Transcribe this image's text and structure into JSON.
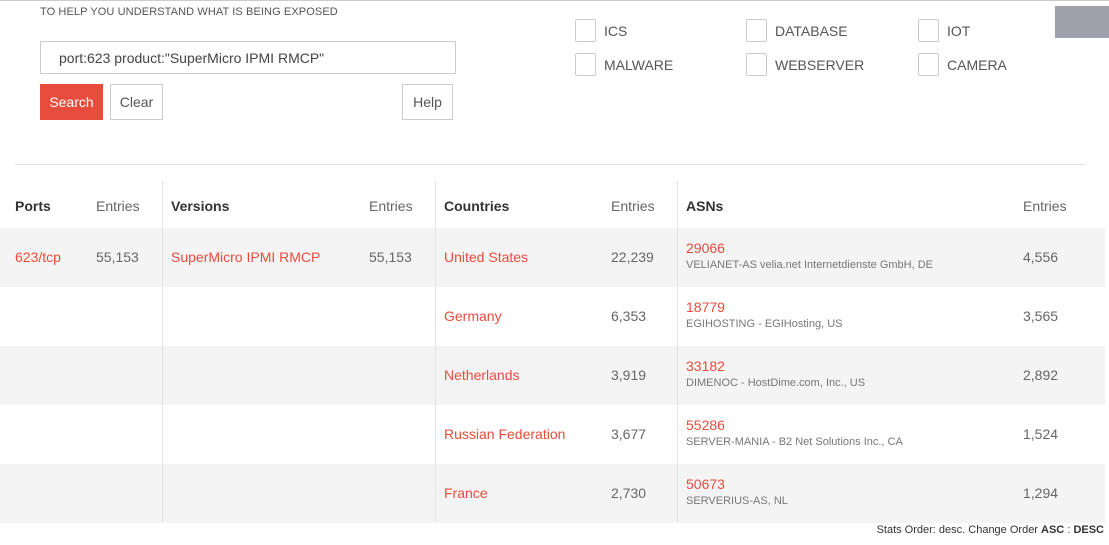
{
  "hint_text": "TO HELP YOU UNDERSTAND WHAT IS BEING EXPOSED",
  "search": {
    "query_value": "port:623 product:\"SuperMicro IPMI RMCP\"",
    "search_label": "Search",
    "clear_label": "Clear",
    "help_label": "Help"
  },
  "filters": [
    "ICS",
    "DATABASE",
    "IOT",
    "MALWARE",
    "WEBSERVER",
    "CAMERA"
  ],
  "headers": {
    "ports": "Ports",
    "versions": "Versions",
    "countries": "Countries",
    "asns": "ASNs",
    "entries": "Entries"
  },
  "ports": [
    {
      "port": "623/tcp",
      "entries": "55,153"
    }
  ],
  "versions": [
    {
      "version": "SuperMicro IPMI RMCP",
      "entries": "55,153"
    }
  ],
  "countries": [
    {
      "name": "United States",
      "entries": "22,239"
    },
    {
      "name": "Germany",
      "entries": "6,353"
    },
    {
      "name": "Netherlands",
      "entries": "3,919"
    },
    {
      "name": "Russian Federation",
      "entries": "3,677"
    },
    {
      "name": "France",
      "entries": "2,730"
    }
  ],
  "asns": [
    {
      "number": "29066",
      "desc": "VELIANET-AS velia.net Internetdienste GmbH, DE",
      "entries": "4,556"
    },
    {
      "number": "18779",
      "desc": "EGIHOSTING - EGIHosting, US",
      "entries": "3,565"
    },
    {
      "number": "33182",
      "desc": "DIMENOC - HostDime.com, Inc., US",
      "entries": "2,892"
    },
    {
      "number": "55286",
      "desc": "SERVER-MANIA - B2 Net Solutions Inc., CA",
      "entries": "1,524"
    },
    {
      "number": "50673",
      "desc": "SERVERIUS-AS, NL",
      "entries": "1,294"
    }
  ],
  "footer": {
    "prefix": "Stats Order: desc. Change Order ",
    "asc": "ASC",
    "sep": " : ",
    "desc": "DESC"
  }
}
